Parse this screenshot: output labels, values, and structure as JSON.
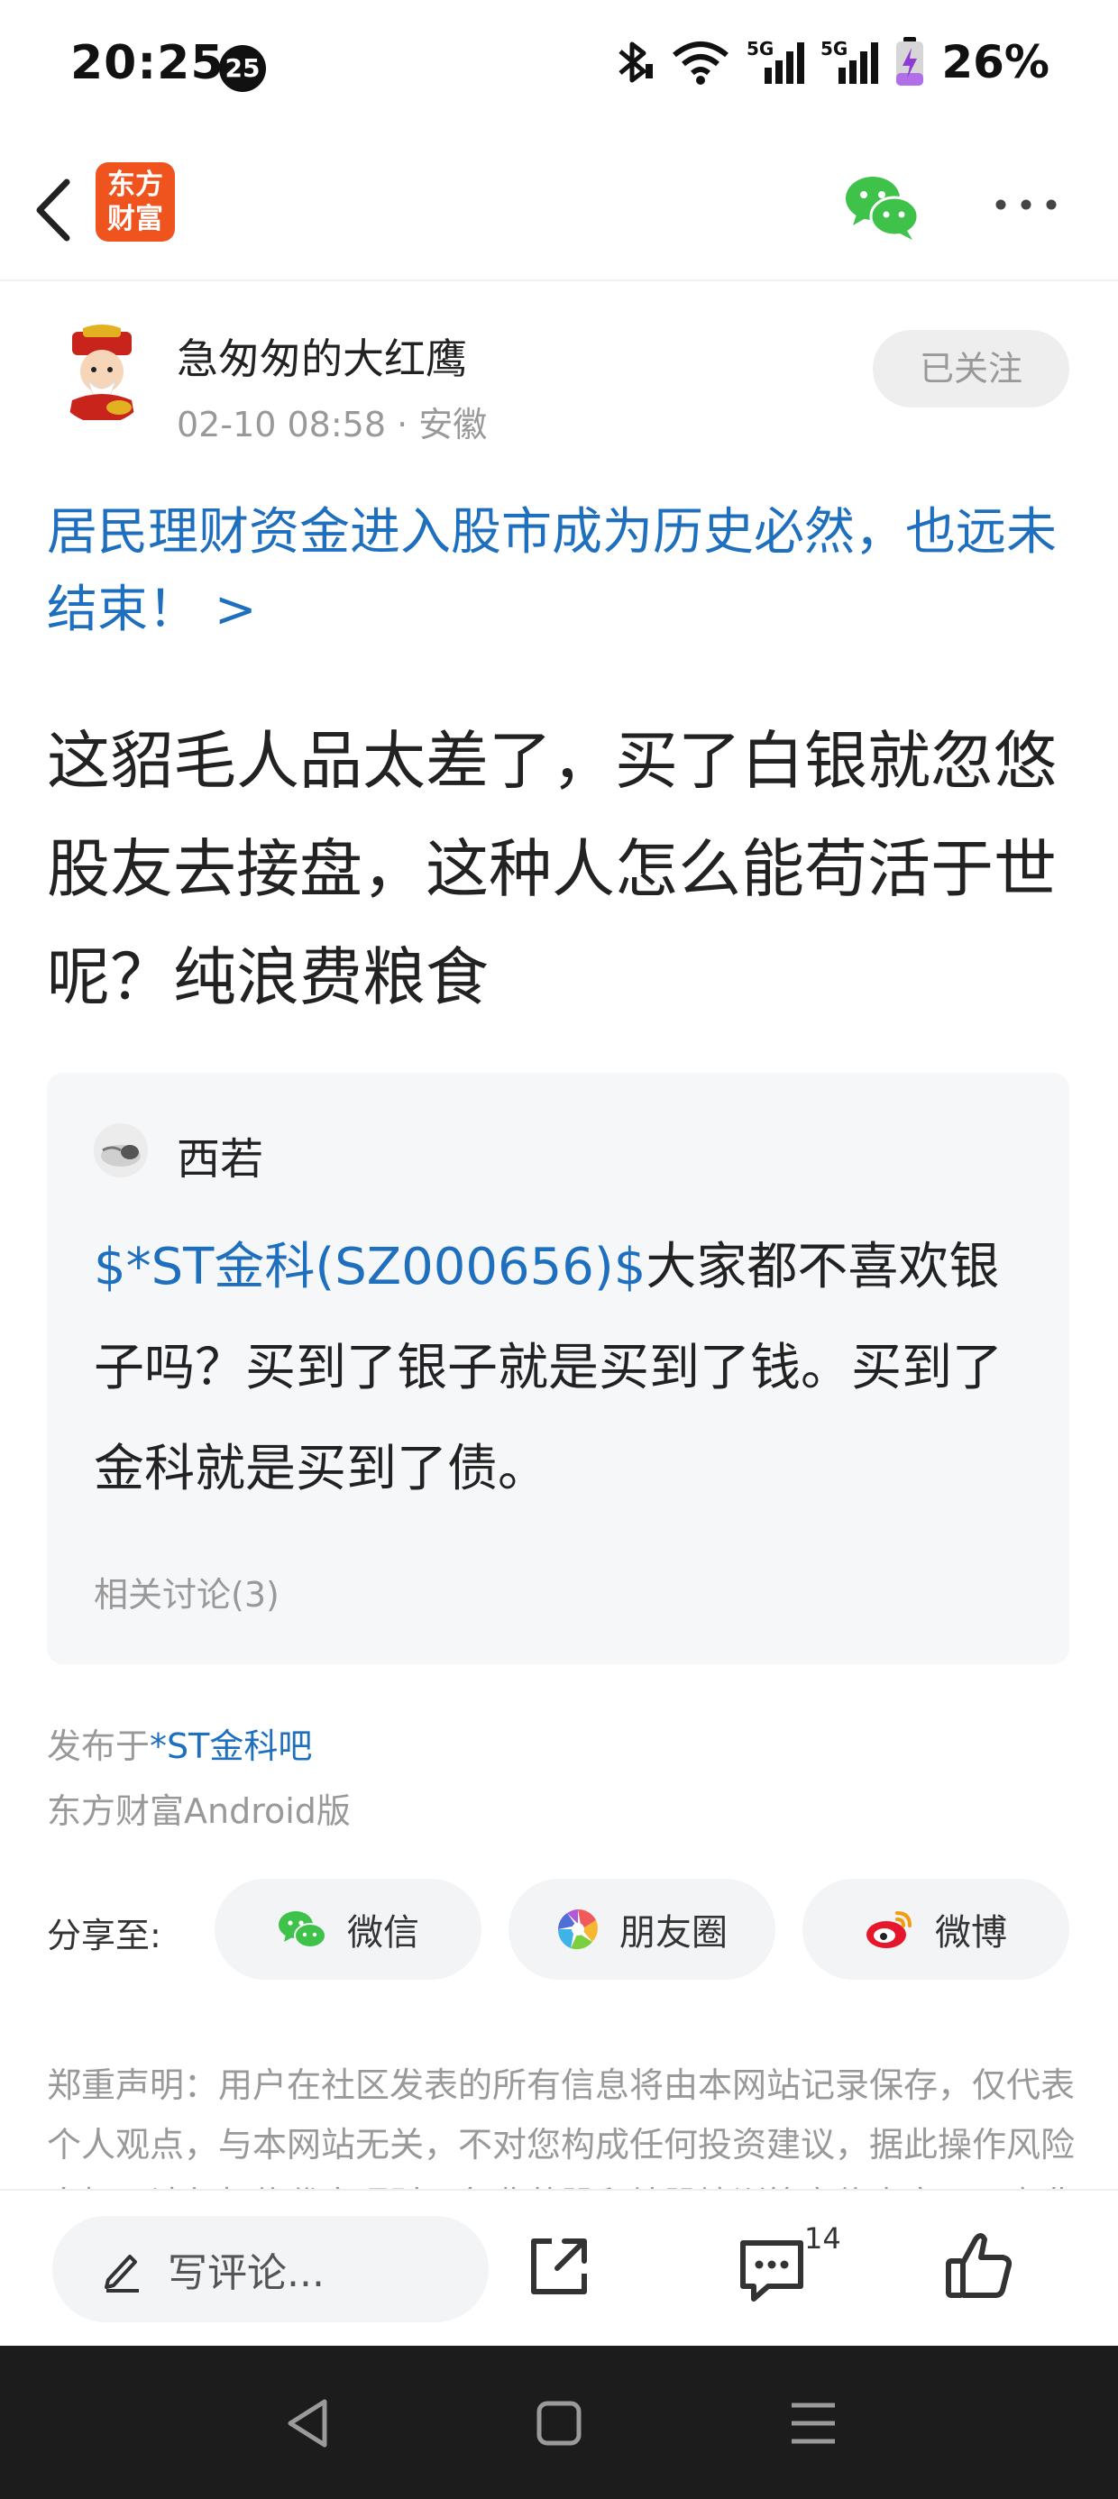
{
  "status_bar": {
    "time": "20:25",
    "badge": "25",
    "battery_percent": "26%",
    "icons": [
      "bluetooth-icon",
      "wifi-icon",
      "signal-5g-icon",
      "signal-5g-icon",
      "battery-charging-icon"
    ]
  },
  "nav": {
    "logo_text": "东方财富",
    "logo_line1": "东方",
    "logo_line2": "财富",
    "back_icon": "chevron-left-icon",
    "share_icon": "wechat-icon",
    "more_icon": "more-dots-icon"
  },
  "author": {
    "name": "急匆匆的大红鹰",
    "datetime": "02-10 08:58",
    "location": "· 安徽",
    "follow_label": "已关注"
  },
  "topic_title": "居民理财资金进入股市成为历史必然，也远未结束！ >",
  "post_body": "这貂毛人品太差了，买了白银就忽悠股友去接盘，这种人怎么能苟活于世呢？纯浪费粮食",
  "quote": {
    "author": "西若",
    "stock_link": "$*ST金科(SZ000656)$",
    "text": "大家都不喜欢银子吗？买到了银子就是买到了钱。买到了金科就是买到了债。",
    "related": "相关讨论(3)"
  },
  "published": {
    "prefix": "发布于",
    "forum": "*ST金科吧",
    "client": "东方财富Android版"
  },
  "share": {
    "label": "分享至:",
    "wechat": "微信",
    "moments": "朋友圈",
    "weibo": "微博"
  },
  "disclaimer": "郑重声明：用户在社区发表的所有信息将由本网站记录保存，仅代表个人观点，与本网站无关，不对您构成任何投资建议，据此操作风险自担。请勿相信代客理财、免费荐股和炒股培训等宣传内容，远离非法证券活动。",
  "action_bar": {
    "comment_placeholder": "写评论...",
    "comment_count": "14",
    "icons": [
      "pencil-icon",
      "share-out-icon",
      "comment-icon",
      "thumbs-up-icon"
    ]
  },
  "colors": {
    "accent_blue": "#1f6fbf",
    "brand_orange": "#f0541e",
    "wechat_green": "#3fc24a"
  }
}
